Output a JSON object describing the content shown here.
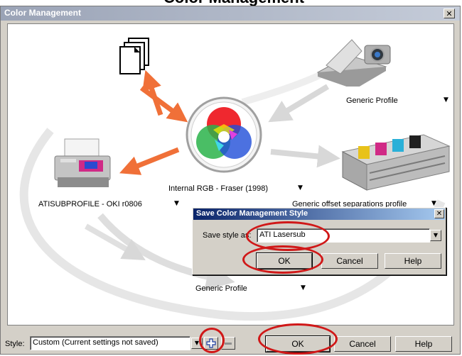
{
  "page_heading": "Color Management",
  "window": {
    "title": "Color Management",
    "close_glyph": "✕"
  },
  "diagram": {
    "input_profile": "Generic Profile",
    "internal_rgb": "Internal RGB - Fraser (1998)",
    "printer_profile": "ATISUBPROFILE - OKI r0806",
    "separations_profile": "Generic offset separations profile",
    "monitor_profile": "Generic Profile",
    "dropdown_glyph": "▼",
    "icons": [
      "documents-icon",
      "scanner-camera-icon",
      "color-wheel-icon",
      "printer-icon",
      "press-icon"
    ]
  },
  "save_dialog": {
    "title": "Save Color Management Style",
    "label": "Save style as:",
    "value": "ATI Lasersub",
    "ok": "OK",
    "cancel": "Cancel",
    "help": "Help"
  },
  "bottom": {
    "style_label": "Style:",
    "style_value": "Custom (Current settings not saved)",
    "ok": "OK",
    "cancel": "Cancel",
    "help": "Help"
  },
  "colors": {
    "highlight_ring": "#d01818",
    "arrow_orange": "#f07038",
    "arrow_gray": "#d8d8d8"
  }
}
